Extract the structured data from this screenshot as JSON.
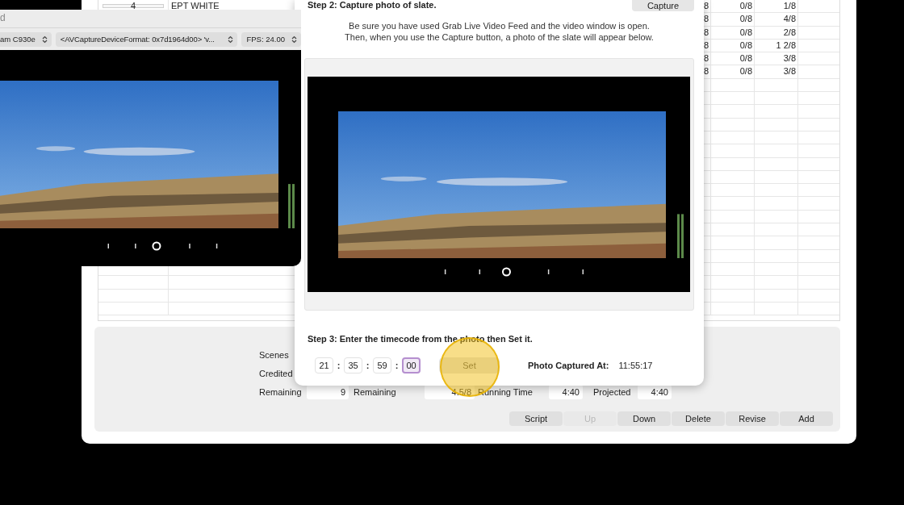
{
  "main_window": {
    "table": {
      "rows": [
        {
          "number": "4",
          "title": "EPT WHITE",
          "column_3": "8",
          "column_4": "0/8",
          "column_5": "1/8",
          "editing": true
        },
        {
          "column_3": "8",
          "column_4": "0/8",
          "column_5": "4/8"
        },
        {
          "column_3": "8",
          "column_4": "0/8",
          "column_5": "2/8"
        },
        {
          "column_3": "8",
          "column_4": "0/8",
          "column_5": "1 2/8"
        },
        {
          "column_3": "8",
          "column_4": "0/8",
          "column_5": "3/8"
        },
        {
          "column_3": "8",
          "column_4": "0/8",
          "column_5": "3/8"
        }
      ]
    },
    "summary": {
      "labels": [
        "Scenes",
        "Credited"
      ],
      "remaining_row": [
        {
          "kind": "label",
          "text": "Remaining"
        },
        {
          "kind": "field",
          "value": "9"
        },
        {
          "kind": "label",
          "text": "Remaining"
        },
        {
          "kind": "field",
          "value": "4.5/8"
        },
        {
          "kind": "label",
          "text": "Running Time"
        },
        {
          "kind": "field",
          "value": "4:40"
        },
        {
          "kind": "label",
          "text": "Projected"
        },
        {
          "kind": "field",
          "value": "4:40"
        }
      ]
    },
    "buttons": [
      {
        "label": "Script",
        "disabled": false
      },
      {
        "label": "Up",
        "disabled": true
      },
      {
        "label": "Down",
        "disabled": false
      },
      {
        "label": "Delete",
        "disabled": false
      },
      {
        "label": "Revise",
        "disabled": false
      },
      {
        "label": "Add",
        "disabled": false
      }
    ]
  },
  "video_window": {
    "title": "d",
    "popups": [
      {
        "value": "am C930e"
      },
      {
        "value": "<AVCaptureDeviceFormat: 0x7d1964d00> 'v..."
      },
      {
        "value": "FPS: 24.00"
      }
    ]
  },
  "capture_sheet": {
    "step2_title": "Step 2: Capture photo of slate.",
    "capture_button": "Capture",
    "instructions": [
      "Be sure you have used Grab Live Video Feed and the video window is open.",
      "Then, when you use the Capture button, a photo of the slate will appear below."
    ],
    "step3_title": "Step 3: Enter the timecode from the photo then Set it.",
    "timecode": [
      {
        "kind": "field",
        "value": "21",
        "focused": false
      },
      {
        "kind": "separator",
        "text": ":"
      },
      {
        "kind": "field",
        "value": "35",
        "focused": false
      },
      {
        "kind": "separator",
        "text": ":"
      },
      {
        "kind": "field",
        "value": "59",
        "focused": false
      },
      {
        "kind": "separator",
        "text": ":"
      },
      {
        "kind": "field",
        "value": "00",
        "focused": true
      }
    ],
    "set_button": "Set",
    "captured_label": "Photo Captured At:",
    "captured_time": "11:55:17"
  }
}
